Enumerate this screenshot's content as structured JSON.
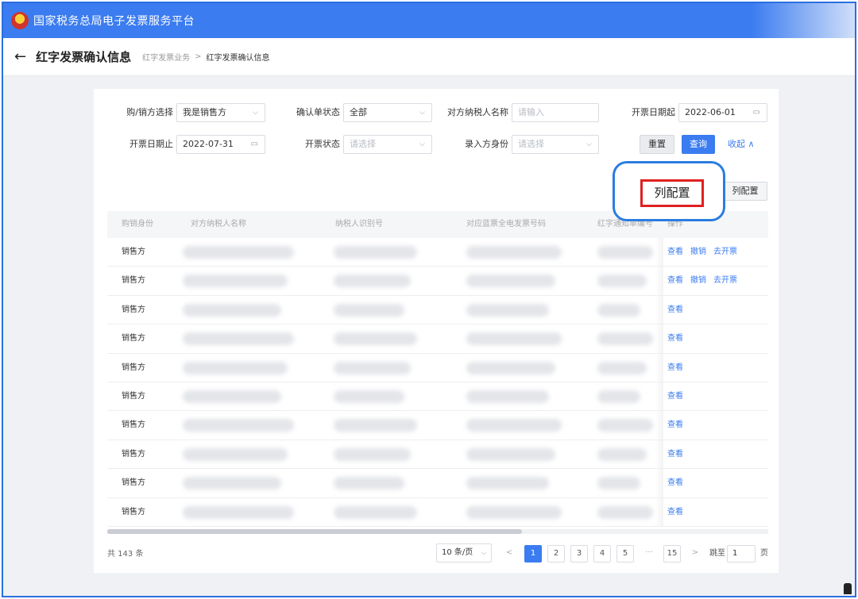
{
  "app": {
    "title": "国家税务总局电子发票服务平台"
  },
  "header": {
    "back_icon": "←",
    "page_title": "红字发票确认信息",
    "breadcrumb": {
      "parent": "红字发票业务",
      "separator": ">",
      "current": "红字发票确认信息"
    }
  },
  "filters": {
    "buyer_seller": {
      "label": "购/销方选择",
      "value": "我是销售方"
    },
    "confirm_status": {
      "label": "确认单状态",
      "value": "全部"
    },
    "counterparty_name": {
      "label": "对方纳税人名称",
      "placeholder": "请输入"
    },
    "date_start": {
      "label": "开票日期起",
      "value": "2022-06-01"
    },
    "date_end": {
      "label": "开票日期止",
      "value": "2022-07-31"
    },
    "invoice_status": {
      "label": "开票状态",
      "placeholder": "请选择"
    },
    "entry_identity": {
      "label": "录入方身份",
      "placeholder": "请选择"
    },
    "reset_label": "重置",
    "query_label": "查询",
    "collapse_label": "收起 ∧"
  },
  "toolbar": {
    "column_config_label": "列配置"
  },
  "callout": {
    "label": "列配置"
  },
  "table": {
    "columns": [
      "购销身份",
      "对方纳税人名称",
      "纳税人识别号",
      "对应蓝票全电发票号码",
      "红字通知单编号",
      "操作"
    ],
    "rows": [
      {
        "role": "销售方",
        "actions": [
          "查看",
          "撤销",
          "去开票"
        ]
      },
      {
        "role": "销售方",
        "actions": [
          "查看",
          "撤销",
          "去开票"
        ]
      },
      {
        "role": "销售方",
        "actions": [
          "查看"
        ]
      },
      {
        "role": "销售方",
        "actions": [
          "查看"
        ]
      },
      {
        "role": "销售方",
        "actions": [
          "查看"
        ]
      },
      {
        "role": "销售方",
        "actions": [
          "查看"
        ]
      },
      {
        "role": "销售方",
        "actions": [
          "查看"
        ]
      },
      {
        "role": "销售方",
        "actions": [
          "查看"
        ]
      },
      {
        "role": "销售方",
        "actions": [
          "查看"
        ]
      },
      {
        "role": "销售方",
        "actions": [
          "查看"
        ]
      }
    ]
  },
  "pagination": {
    "total": "共 143 条",
    "page_size": "10 条/页",
    "prev": "<",
    "pages": [
      "1",
      "2",
      "3",
      "4",
      "5"
    ],
    "ellipsis": "···",
    "last_page": "15",
    "next": ">",
    "jump_label": "跳至",
    "jump_value": "1",
    "page_suffix": "页",
    "current_page": 1
  },
  "colors": {
    "brand_blue": "#3b7cf0",
    "callout_border": "#2a7de0",
    "highlight_red": "#e02020"
  }
}
